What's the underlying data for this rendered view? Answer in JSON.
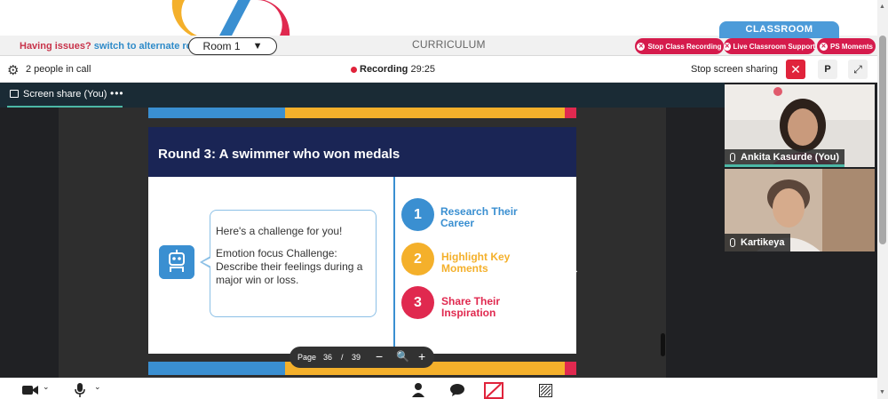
{
  "top": {
    "issues_text": "Having issues?",
    "issues_link": "switch to alternate room",
    "room_select": "Room 1",
    "curriculum_label": "CURRICULUM",
    "classroom_tab": "CLASSROOM",
    "pills": [
      {
        "label": "Stop Class Recording"
      },
      {
        "label": "Live Classroom Support"
      },
      {
        "label": "PS Moments"
      }
    ]
  },
  "call": {
    "people_in_call": "2 people in call",
    "recording_label": "Recording",
    "recording_time": "29:25",
    "stop_share_label": "Stop screen sharing",
    "p_button": "P"
  },
  "stage": {
    "share_label": "Screen share (You)",
    "share_menu": "•••"
  },
  "slide": {
    "title": "Round 3: A swimmer who won medals",
    "bubble_line1": "Here's a challenge for you!",
    "bubble_line2": "Emotion focus Challenge: Describe their feelings during a major win or loss.",
    "steps": [
      {
        "num": "1",
        "text": "Research Their Career",
        "color": "#3a8fd1"
      },
      {
        "num": "2",
        "text": "Highlight Key Moments",
        "color": "#f4b02b"
      },
      {
        "num": "3",
        "text": "Share Their Inspiration",
        "color": "#e0294f"
      }
    ]
  },
  "pager": {
    "label": "Page",
    "current": "36",
    "separator": "/",
    "total": "39",
    "minus": "−",
    "plus": "+"
  },
  "participants": [
    {
      "name": "Ankita Kasurde (You)"
    },
    {
      "name": "Kartikeya"
    }
  ],
  "colors": {
    "accent_red": "#d51b4c",
    "accent_blue": "#3a8fd1",
    "accent_yellow": "#f4b02b",
    "slide_title_bg": "#1a2555"
  }
}
